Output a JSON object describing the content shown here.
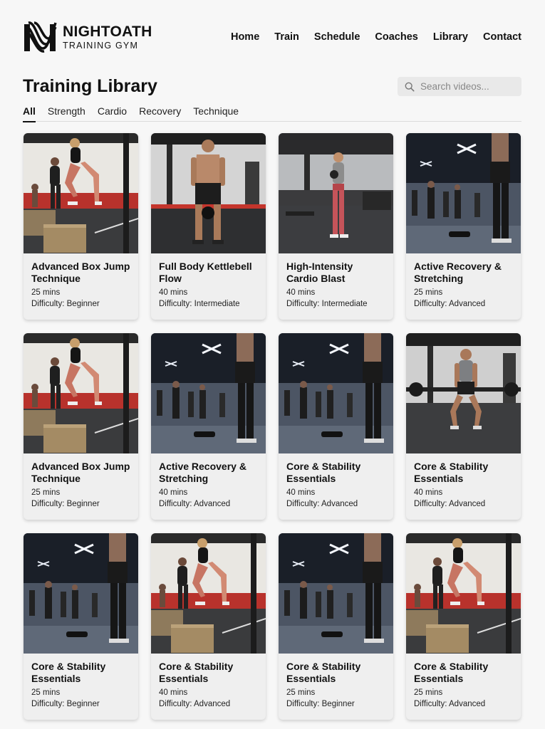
{
  "brand": {
    "name": "NIGHTOATH",
    "subtitle": "TRAINING GYM"
  },
  "nav": [
    {
      "label": "Home"
    },
    {
      "label": "Train"
    },
    {
      "label": "Schedule"
    },
    {
      "label": "Coaches"
    },
    {
      "label": "Library"
    },
    {
      "label": "Contact"
    }
  ],
  "page": {
    "title": "Training Library"
  },
  "search": {
    "placeholder": "Search videos..."
  },
  "tabs": [
    {
      "label": "All",
      "active": true
    },
    {
      "label": "Strength",
      "active": false
    },
    {
      "label": "Cardio",
      "active": false
    },
    {
      "label": "Recovery",
      "active": false
    },
    {
      "label": "Technique",
      "active": false
    }
  ],
  "videos": [
    {
      "title": "Advanced Box Jump Technique",
      "duration": "25 mins",
      "difficulty": "Difficulty: Beginner",
      "scene": "boxjump"
    },
    {
      "title": "Full Body Kettlebell Flow",
      "duration": "40 mins",
      "difficulty": "Difficulty: Intermediate",
      "scene": "kettlebell"
    },
    {
      "title": "High-Intensity Cardio Blast",
      "duration": "40 mins",
      "difficulty": "Difficulty: Intermediate",
      "scene": "cardio"
    },
    {
      "title": "Active Recovery & Stretching",
      "duration": "25 mins",
      "difficulty": "Difficulty: Advanced",
      "scene": "darkgym"
    },
    {
      "title": "Advanced Box Jump Technique",
      "duration": "25 mins",
      "difficulty": "Difficulty: Beginner",
      "scene": "boxjump"
    },
    {
      "title": "Active Recovery & Stretching",
      "duration": "40 mins",
      "difficulty": "Difficulty: Advanced",
      "scene": "darkgym"
    },
    {
      "title": "Core & Stability Essentials",
      "duration": "40 mins",
      "difficulty": "Difficulty: Advanced",
      "scene": "darkgym"
    },
    {
      "title": "Core & Stability Essentials",
      "duration": "40 mins",
      "difficulty": "Difficulty: Advanced",
      "scene": "squat"
    },
    {
      "title": "Core & Stability Essentials",
      "duration": "25 mins",
      "difficulty": "Difficulty: Beginner",
      "scene": "darkgym"
    },
    {
      "title": "Core & Stability Essentials",
      "duration": "40 mins",
      "difficulty": "Difficulty: Advanced",
      "scene": "boxjump"
    },
    {
      "title": "Core & Stability Essentials",
      "duration": "25 mins",
      "difficulty": "Difficulty: Beginner",
      "scene": "darkgym"
    },
    {
      "title": "Core & Stability Essentials",
      "duration": "25 mins",
      "difficulty": "Difficulty: Advanced",
      "scene": "boxjump"
    }
  ]
}
